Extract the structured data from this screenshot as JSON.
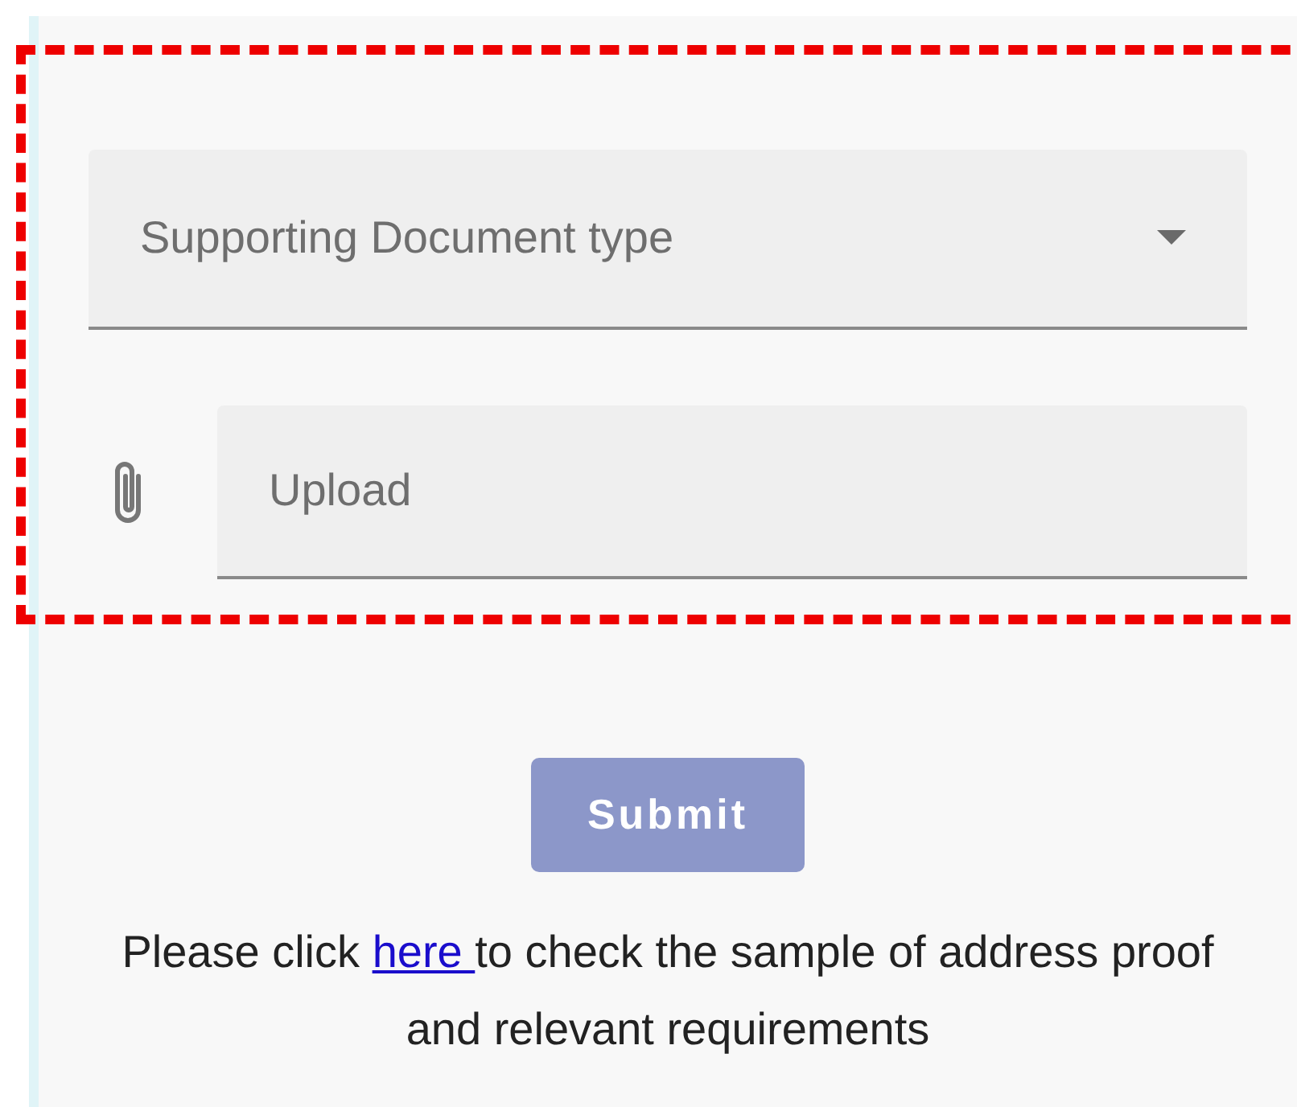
{
  "document_type_field": {
    "placeholder": "Supporting Document type"
  },
  "upload_field": {
    "placeholder": "Upload"
  },
  "submit_button": {
    "label": "Submit",
    "disabled": true
  },
  "note": {
    "before": "Please click ",
    "link": "here ",
    "after": "to check the sample of address proof and relevant requirements"
  }
}
